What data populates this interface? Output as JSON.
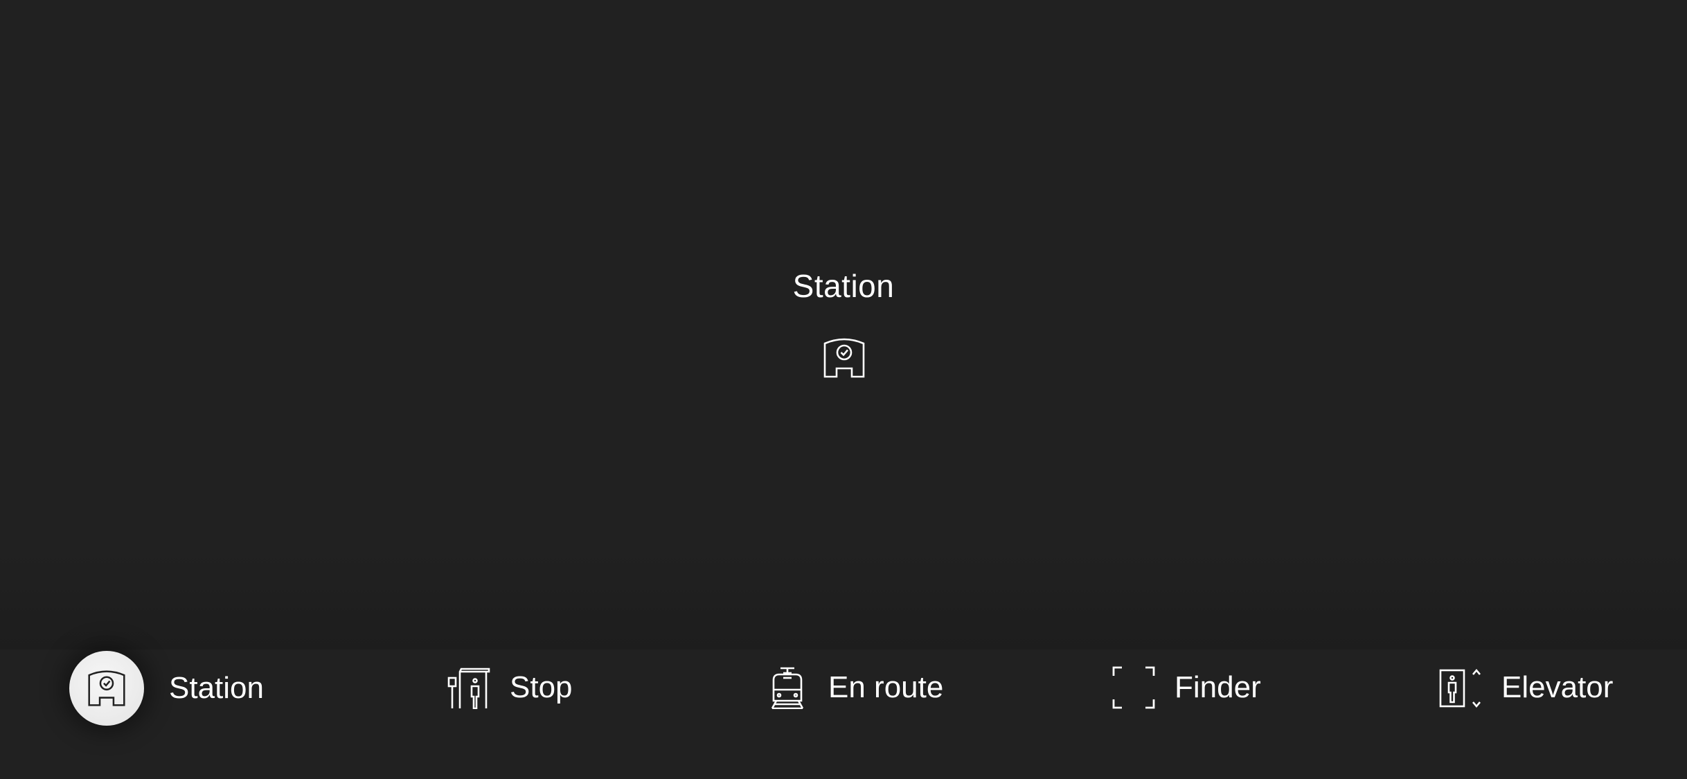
{
  "main": {
    "title": "Station",
    "hero_icon": "station-clock-icon"
  },
  "tabbar": {
    "selected": "station",
    "tabs": [
      {
        "id": "station",
        "label": "Station",
        "icon": "station-clock-icon"
      },
      {
        "id": "stop",
        "label": "Stop",
        "icon": "stop-shelter-icon"
      },
      {
        "id": "en_route",
        "label": "En route",
        "icon": "tram-icon"
      },
      {
        "id": "finder",
        "label": "Finder",
        "icon": "viewfinder-icon"
      },
      {
        "id": "elevator",
        "label": "Elevator",
        "icon": "elevator-icon"
      }
    ]
  },
  "colors": {
    "background": "#212121",
    "text": "#ffffff",
    "selected_circle": "#eeeeee",
    "selected_icon": "#222222"
  }
}
